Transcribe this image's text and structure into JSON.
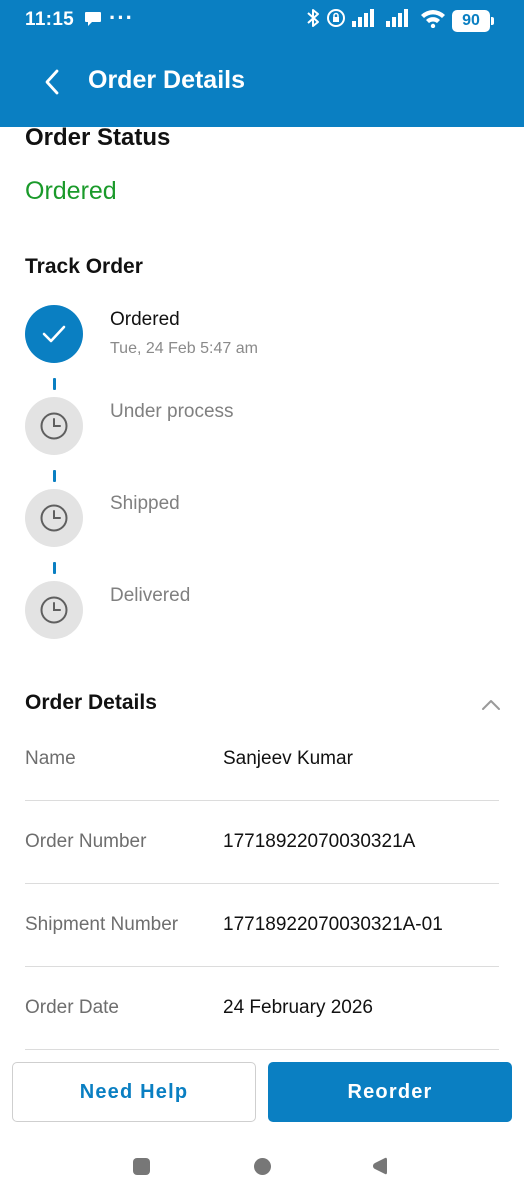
{
  "status_bar": {
    "time": "11:15",
    "more": "···",
    "battery": "90"
  },
  "app_bar": {
    "title": "Order Details",
    "back_icon": "chevron-left-icon"
  },
  "order_status": {
    "title": "Order Status",
    "value": "Ordered",
    "value_color": "#1a9a2a"
  },
  "track_order": {
    "title": "Track Order",
    "steps": [
      {
        "label": "Ordered",
        "date": "Tue, 24 Feb 5:47 am",
        "done": true
      },
      {
        "label": "Under process",
        "done": false
      },
      {
        "label": "Shipped",
        "done": false
      },
      {
        "label": "Delivered",
        "done": false
      }
    ]
  },
  "order_details": {
    "title": "Order Details",
    "rows": [
      {
        "key": "Name",
        "value": "Sanjeev Kumar"
      },
      {
        "key": "Order Number",
        "value": "17718922070030321A"
      },
      {
        "key": "Shipment Number",
        "value": "17718922070030321A-01"
      },
      {
        "key": "Order Date",
        "value": "24 February 2026"
      }
    ]
  },
  "actions": {
    "help_label": "Need Help",
    "reorder_label": "Reorder"
  },
  "colors": {
    "brand": "#0a7fc2",
    "success": "#1a9a2a",
    "pending_circle": "#e3e3e3"
  }
}
